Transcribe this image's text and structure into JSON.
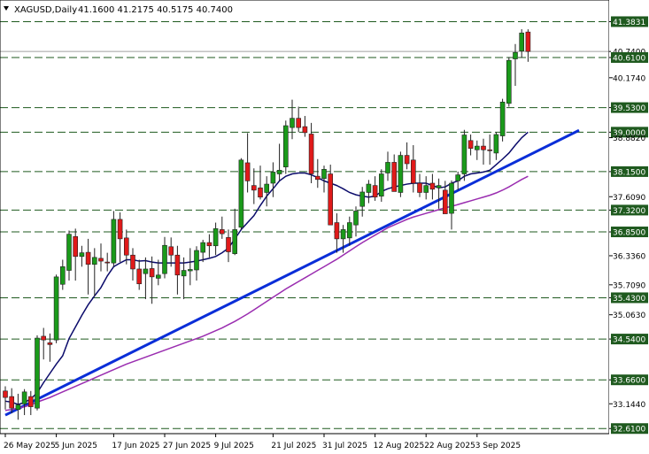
{
  "header": {
    "symbol": "XAGUSD,Daily",
    "ohlc": "41.1600 41.2175 40.5175 40.7400"
  },
  "chart_data": {
    "type": "candlestick",
    "symbol": "XAGUSD",
    "timeframe": "Daily",
    "ylim": [
      32.5,
      41.85
    ],
    "y_ticks": [
      {
        "value": 41.3831,
        "label": "41.3831",
        "style": "level"
      },
      {
        "value": 40.74,
        "label": "40.7400",
        "style": "price"
      },
      {
        "value": 40.61,
        "label": "40.6100",
        "style": "level"
      },
      {
        "value": 40.174,
        "label": "40.1740",
        "style": "plain"
      },
      {
        "value": 39.53,
        "label": "39.5300",
        "style": "level"
      },
      {
        "value": 39.0,
        "label": "39.0000",
        "style": "level"
      },
      {
        "value": 38.882,
        "label": "38.8820",
        "style": "plain"
      },
      {
        "value": 38.15,
        "label": "38.1500",
        "style": "level"
      },
      {
        "value": 37.609,
        "label": "37.6090",
        "style": "plain"
      },
      {
        "value": 37.32,
        "label": "37.3200",
        "style": "level"
      },
      {
        "value": 36.85,
        "label": "36.8500",
        "style": "level"
      },
      {
        "value": 36.336,
        "label": "36.3360",
        "style": "plain"
      },
      {
        "value": 35.709,
        "label": "35.7090",
        "style": "plain"
      },
      {
        "value": 35.43,
        "label": "35.4300",
        "style": "level"
      },
      {
        "value": 35.063,
        "label": "35.0630",
        "style": "plain"
      },
      {
        "value": 34.54,
        "label": "34.5400",
        "style": "level"
      },
      {
        "value": 33.66,
        "label": "33.6600",
        "style": "level"
      },
      {
        "value": 33.144,
        "label": "33.1440",
        "style": "plain"
      },
      {
        "value": 32.61,
        "label": "32.6100",
        "style": "level"
      }
    ],
    "x_ticks": [
      {
        "index": 0,
        "label": "26 May 2025"
      },
      {
        "index": 8,
        "label": "5 Jun 2025"
      },
      {
        "index": 17,
        "label": "17 Jun 2025"
      },
      {
        "index": 25,
        "label": "27 Jun 2025"
      },
      {
        "index": 33,
        "label": "9 Jul 2025"
      },
      {
        "index": 42,
        "label": "21 Jul 2025"
      },
      {
        "index": 50,
        "label": "31 Jul 2025"
      },
      {
        "index": 58,
        "label": "12 Aug 2025"
      },
      {
        "index": 66,
        "label": "22 Aug 2025"
      },
      {
        "index": 74,
        "label": "3 Sep 2025"
      }
    ],
    "horizontal_levels": [
      41.3831,
      40.61,
      39.53,
      39.0,
      38.15,
      37.32,
      36.85,
      35.43,
      34.54,
      33.66,
      32.61
    ],
    "current_price": 40.74,
    "candles": [
      {
        "o": 33.42,
        "h": 33.52,
        "l": 33.02,
        "c": 33.28
      },
      {
        "o": 33.3,
        "h": 33.48,
        "l": 32.94,
        "c": 33.05
      },
      {
        "o": 33.02,
        "h": 33.36,
        "l": 32.8,
        "c": 33.12
      },
      {
        "o": 33.14,
        "h": 33.46,
        "l": 32.9,
        "c": 33.4
      },
      {
        "o": 33.3,
        "h": 33.42,
        "l": 32.9,
        "c": 33.08
      },
      {
        "o": 33.05,
        "h": 34.62,
        "l": 33.0,
        "c": 34.56
      },
      {
        "o": 34.6,
        "h": 34.78,
        "l": 34.1,
        "c": 34.52
      },
      {
        "o": 34.46,
        "h": 34.66,
        "l": 34.05,
        "c": 34.42
      },
      {
        "o": 34.52,
        "h": 35.93,
        "l": 34.45,
        "c": 35.88
      },
      {
        "o": 35.72,
        "h": 36.25,
        "l": 35.6,
        "c": 36.1
      },
      {
        "o": 36.02,
        "h": 36.88,
        "l": 35.8,
        "c": 36.8
      },
      {
        "o": 36.75,
        "h": 36.92,
        "l": 35.8,
        "c": 36.32
      },
      {
        "o": 36.32,
        "h": 36.55,
        "l": 36.1,
        "c": 36.4
      },
      {
        "o": 36.41,
        "h": 36.7,
        "l": 35.5,
        "c": 36.15
      },
      {
        "o": 36.15,
        "h": 36.5,
        "l": 35.46,
        "c": 36.3
      },
      {
        "o": 36.28,
        "h": 36.6,
        "l": 36.0,
        "c": 36.22
      },
      {
        "o": 36.2,
        "h": 36.4,
        "l": 36.0,
        "c": 36.18
      },
      {
        "o": 36.18,
        "h": 37.3,
        "l": 36.1,
        "c": 37.12
      },
      {
        "o": 37.12,
        "h": 37.27,
        "l": 36.2,
        "c": 36.7
      },
      {
        "o": 36.72,
        "h": 36.9,
        "l": 36.15,
        "c": 36.35
      },
      {
        "o": 36.35,
        "h": 36.5,
        "l": 35.8,
        "c": 36.05
      },
      {
        "o": 36.05,
        "h": 36.25,
        "l": 35.6,
        "c": 35.73
      },
      {
        "o": 35.95,
        "h": 36.3,
        "l": 35.4,
        "c": 36.05
      },
      {
        "o": 36.06,
        "h": 36.32,
        "l": 35.3,
        "c": 35.88
      },
      {
        "o": 35.85,
        "h": 36.25,
        "l": 35.7,
        "c": 35.92
      },
      {
        "o": 35.95,
        "h": 36.74,
        "l": 35.85,
        "c": 36.56
      },
      {
        "o": 36.53,
        "h": 36.73,
        "l": 36.1,
        "c": 36.35
      },
      {
        "o": 36.35,
        "h": 36.55,
        "l": 35.5,
        "c": 35.92
      },
      {
        "o": 35.9,
        "h": 36.3,
        "l": 35.4,
        "c": 36.02
      },
      {
        "o": 36.01,
        "h": 36.5,
        "l": 35.7,
        "c": 36.04
      },
      {
        "o": 36.03,
        "h": 36.54,
        "l": 35.8,
        "c": 36.45
      },
      {
        "o": 36.41,
        "h": 36.68,
        "l": 36.2,
        "c": 36.62
      },
      {
        "o": 36.62,
        "h": 36.8,
        "l": 36.3,
        "c": 36.55
      },
      {
        "o": 36.55,
        "h": 37.05,
        "l": 36.35,
        "c": 36.92
      },
      {
        "o": 36.9,
        "h": 37.18,
        "l": 36.7,
        "c": 36.81
      },
      {
        "o": 36.73,
        "h": 36.9,
        "l": 36.2,
        "c": 36.42
      },
      {
        "o": 36.38,
        "h": 37.35,
        "l": 36.35,
        "c": 36.9
      },
      {
        "o": 36.95,
        "h": 38.44,
        "l": 36.9,
        "c": 38.4
      },
      {
        "o": 38.34,
        "h": 38.98,
        "l": 37.7,
        "c": 37.95
      },
      {
        "o": 37.85,
        "h": 38.22,
        "l": 37.45,
        "c": 37.75
      },
      {
        "o": 37.8,
        "h": 38.28,
        "l": 37.55,
        "c": 37.6
      },
      {
        "o": 37.7,
        "h": 38.05,
        "l": 37.4,
        "c": 37.88
      },
      {
        "o": 37.9,
        "h": 38.35,
        "l": 37.6,
        "c": 38.14
      },
      {
        "o": 38.1,
        "h": 38.75,
        "l": 37.95,
        "c": 38.18
      },
      {
        "o": 38.25,
        "h": 39.25,
        "l": 38.1,
        "c": 39.14
      },
      {
        "o": 39.1,
        "h": 39.7,
        "l": 38.85,
        "c": 39.3
      },
      {
        "o": 39.3,
        "h": 39.55,
        "l": 39.0,
        "c": 39.1
      },
      {
        "o": 39.12,
        "h": 39.35,
        "l": 38.9,
        "c": 38.99
      },
      {
        "o": 38.96,
        "h": 39.2,
        "l": 37.9,
        "c": 38.1
      },
      {
        "o": 38.05,
        "h": 38.42,
        "l": 37.8,
        "c": 37.98
      },
      {
        "o": 38.0,
        "h": 38.28,
        "l": 37.7,
        "c": 38.2
      },
      {
        "o": 38.1,
        "h": 38.3,
        "l": 37.3,
        "c": 37.0
      },
      {
        "o": 37.05,
        "h": 37.25,
        "l": 36.4,
        "c": 36.7
      },
      {
        "o": 36.7,
        "h": 37.0,
        "l": 36.4,
        "c": 36.9
      },
      {
        "o": 36.72,
        "h": 37.18,
        "l": 36.55,
        "c": 37.05
      },
      {
        "o": 37.0,
        "h": 37.4,
        "l": 36.75,
        "c": 37.3
      },
      {
        "o": 37.4,
        "h": 37.82,
        "l": 37.18,
        "c": 37.71
      },
      {
        "o": 37.7,
        "h": 37.97,
        "l": 37.47,
        "c": 37.88
      },
      {
        "o": 37.85,
        "h": 38.05,
        "l": 37.52,
        "c": 37.6
      },
      {
        "o": 37.62,
        "h": 38.2,
        "l": 37.5,
        "c": 38.1
      },
      {
        "o": 38.12,
        "h": 38.58,
        "l": 37.95,
        "c": 38.35
      },
      {
        "o": 38.35,
        "h": 38.52,
        "l": 37.85,
        "c": 37.72
      },
      {
        "o": 37.7,
        "h": 38.58,
        "l": 37.6,
        "c": 38.5
      },
      {
        "o": 38.5,
        "h": 38.78,
        "l": 38.2,
        "c": 38.32
      },
      {
        "o": 38.4,
        "h": 38.72,
        "l": 37.7,
        "c": 37.9
      },
      {
        "o": 37.9,
        "h": 38.1,
        "l": 37.6,
        "c": 37.7
      },
      {
        "o": 37.7,
        "h": 38.05,
        "l": 37.55,
        "c": 37.85
      },
      {
        "o": 37.9,
        "h": 38.1,
        "l": 37.55,
        "c": 37.77
      },
      {
        "o": 37.8,
        "h": 38.0,
        "l": 37.35,
        "c": 37.85
      },
      {
        "o": 37.75,
        "h": 37.95,
        "l": 37.4,
        "c": 37.24
      },
      {
        "o": 37.25,
        "h": 37.96,
        "l": 36.9,
        "c": 37.9
      },
      {
        "o": 37.95,
        "h": 38.15,
        "l": 37.75,
        "c": 38.08
      },
      {
        "o": 38.1,
        "h": 39.05,
        "l": 37.95,
        "c": 38.94
      },
      {
        "o": 38.82,
        "h": 38.95,
        "l": 38.5,
        "c": 38.65
      },
      {
        "o": 38.62,
        "h": 38.82,
        "l": 38.4,
        "c": 38.7
      },
      {
        "o": 38.7,
        "h": 38.86,
        "l": 38.3,
        "c": 38.62
      },
      {
        "o": 38.62,
        "h": 38.95,
        "l": 38.3,
        "c": 38.6
      },
      {
        "o": 38.55,
        "h": 39.0,
        "l": 38.4,
        "c": 38.95
      },
      {
        "o": 38.92,
        "h": 39.72,
        "l": 38.8,
        "c": 39.65
      },
      {
        "o": 39.62,
        "h": 40.62,
        "l": 39.55,
        "c": 40.55
      },
      {
        "o": 40.58,
        "h": 40.9,
        "l": 40.0,
        "c": 40.72
      },
      {
        "o": 40.75,
        "h": 41.22,
        "l": 40.6,
        "c": 41.14
      },
      {
        "o": 41.16,
        "h": 41.2175,
        "l": 40.5175,
        "c": 40.74
      }
    ],
    "moving_averages": [
      {
        "name": "",
        "color": "#0b0b6b",
        "values": [
          33.2,
          33.18,
          33.13,
          33.17,
          33.25,
          33.38,
          33.6,
          33.8,
          34.0,
          34.18,
          34.55,
          34.8,
          35.05,
          35.28,
          35.47,
          35.65,
          35.9,
          36.1,
          36.18,
          36.25,
          36.25,
          36.22,
          36.23,
          36.2,
          36.18,
          36.18,
          36.18,
          36.18,
          36.18,
          36.2,
          36.22,
          36.25,
          36.28,
          36.32,
          36.4,
          36.5,
          36.7,
          36.9,
          37.05,
          37.2,
          37.42,
          37.62,
          37.78,
          37.95,
          38.05,
          38.1,
          38.12,
          38.12,
          38.08,
          38.02,
          37.95,
          37.9,
          37.85,
          37.78,
          37.7,
          37.65,
          37.62,
          37.6,
          37.62,
          37.72,
          37.78,
          37.82,
          37.85,
          37.88,
          37.9,
          37.9,
          37.9,
          37.85,
          37.8,
          37.82,
          37.9,
          37.95,
          38.05,
          38.1,
          38.12,
          38.14,
          38.18,
          38.3,
          38.42,
          38.55,
          38.72,
          38.88,
          39.0
        ]
      },
      {
        "name": "",
        "color": "#9a2db0",
        "values": [
          33.0,
          33.02,
          33.05,
          33.08,
          33.12,
          33.18,
          33.23,
          33.28,
          33.34,
          33.4,
          33.46,
          33.52,
          33.58,
          33.64,
          33.7,
          33.76,
          33.82,
          33.88,
          33.94,
          34.0,
          34.05,
          34.1,
          34.15,
          34.2,
          34.25,
          34.3,
          34.35,
          34.4,
          34.45,
          34.5,
          34.55,
          34.6,
          34.66,
          34.72,
          34.78,
          34.85,
          34.92,
          35.0,
          35.08,
          35.17,
          35.26,
          35.35,
          35.44,
          35.53,
          35.62,
          35.7,
          35.78,
          35.86,
          35.94,
          36.02,
          36.1,
          36.18,
          36.26,
          36.35,
          36.44,
          36.53,
          36.62,
          36.7,
          36.78,
          36.86,
          36.94,
          37.0,
          37.06,
          37.12,
          37.17,
          37.21,
          37.25,
          37.29,
          37.33,
          37.37,
          37.4,
          37.44,
          37.48,
          37.52,
          37.56,
          37.6,
          37.64,
          37.69,
          37.75,
          37.82,
          37.9,
          37.98,
          38.05
        ]
      }
    ],
    "trendline": {
      "start": {
        "index": 0,
        "value": 32.9
      },
      "end": {
        "index": 90,
        "value": 39.04
      },
      "color": "#0a2ed8"
    }
  }
}
